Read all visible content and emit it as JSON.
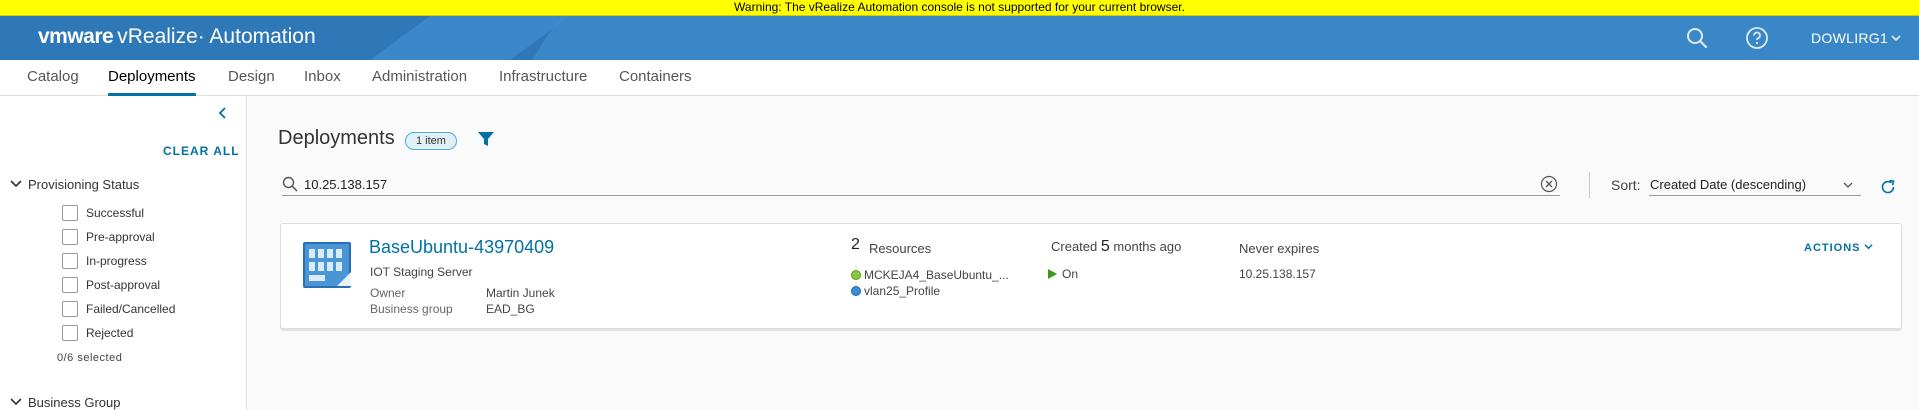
{
  "warning": "Warning: The vRealize Automation console is not supported for your current browser.",
  "header": {
    "brand_vmware": "vmware",
    "brand_product": "vRealize· Automation",
    "user": "DOWLIRG1",
    "icons": [
      "search-icon",
      "help-icon"
    ]
  },
  "nav": {
    "tabs": [
      {
        "label": "Catalog"
      },
      {
        "label": "Deployments"
      },
      {
        "label": "Design"
      },
      {
        "label": "Inbox"
      },
      {
        "label": "Administration"
      },
      {
        "label": "Infrastructure"
      },
      {
        "label": "Containers"
      }
    ],
    "active": "Deployments"
  },
  "sidebar": {
    "clear_all": "CLEAR ALL",
    "provisioning_status": {
      "title": "Provisioning Status",
      "options": [
        {
          "label": "Successful",
          "checked": false
        },
        {
          "label": "Pre-approval",
          "checked": false
        },
        {
          "label": "In-progress",
          "checked": false
        },
        {
          "label": "Post-approval",
          "checked": false
        },
        {
          "label": "Failed/Cancelled",
          "checked": false
        },
        {
          "label": "Rejected",
          "checked": false
        }
      ],
      "selected_count": "0/6  selected"
    },
    "business_group": {
      "title": "Business Group"
    }
  },
  "main": {
    "title": "Deployments",
    "item_count": "1 item",
    "search": {
      "value": "10.25.138.157",
      "placeholder": ""
    },
    "sort": {
      "label": "Sort:",
      "value": "Created Date (descending)"
    }
  },
  "deployment": {
    "name": "BaseUbuntu-43970409",
    "description": "IOT Staging Server",
    "owner_label": "Owner",
    "owner": "Martin Junek",
    "business_group_label": "Business group",
    "business_group": "EAD_BG",
    "resources_count": "2",
    "resources_label": "Resources",
    "resources": [
      "MCKEJA4_BaseUbuntu_...",
      "vlan25_Profile"
    ],
    "created_prefix": "Created",
    "created_value": "5",
    "created_suffix": "months ago",
    "power_state": "On",
    "expires": "Never expires",
    "ip": "10.25.138.157",
    "actions": "ACTIONS"
  },
  "colors": {
    "header_bg": "#3a87c8",
    "warning_bg": "#ffff00",
    "accent": "#0072a3",
    "power_on": "#3c9a1a"
  }
}
